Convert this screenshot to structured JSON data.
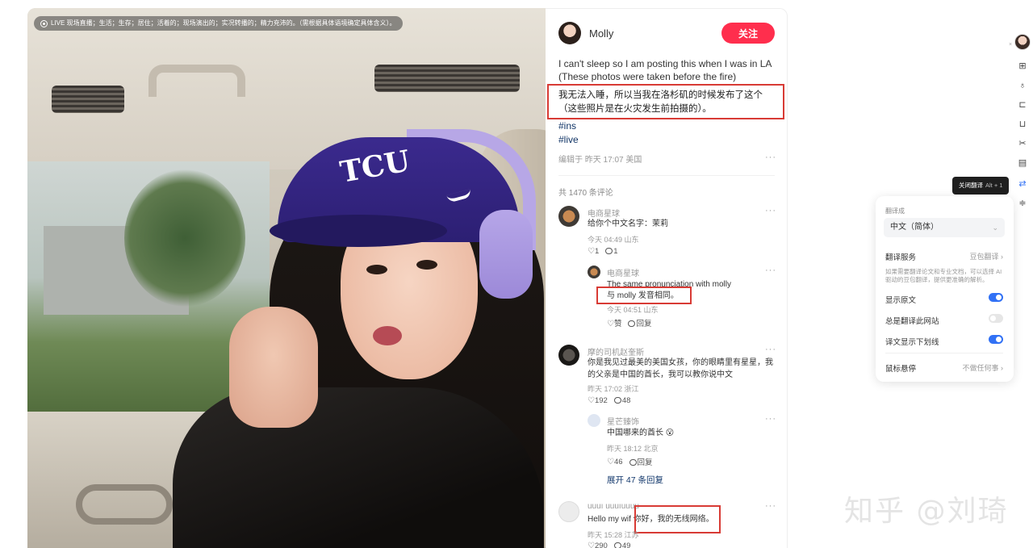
{
  "live_banner": "LIVE 现场直播；生活；生存；居住；活着的；现场演出的；实况转播的；精力充沛的。（需根据具体语境确定具体含义）。",
  "author": {
    "name": "Molly",
    "follow_label": "关注"
  },
  "post": {
    "line1": "I can't sleep so I am posting this when I was in LA",
    "line2": "(These photos were taken before the fire)",
    "translation": "我无法入睡，所以当我在洛杉矶的时候发布了这个（这些照片是在火灾发生前拍摄的）。",
    "tags": [
      "#ins",
      "#live"
    ],
    "edited": "编辑于 昨天 17:07 美国",
    "more": "···"
  },
  "comments_total": "共 1470 条评论",
  "comments": [
    {
      "name": "电商星球",
      "text": "给你个中文名字：茉莉",
      "time": "今天 04:49 山东",
      "likes": "1",
      "replies": "1"
    },
    {
      "name": "电商星球",
      "text1": "The same pronunciation with molly",
      "text2": "与 molly 发音相同。",
      "time": "今天 04:51 山东",
      "like_label": "赞",
      "reply_label": "回复"
    },
    {
      "name": "摩的司机赵奎斯",
      "text": "你是我见过最美的美国女孩，你的眼睛里有星星，我的父亲是中国的酋长，我可以教你说中文",
      "time": "昨天 17:02 浙江",
      "likes": "192",
      "replies": "48"
    },
    {
      "name": "星芒臻饰",
      "text": "中国哪来的酋长 😮",
      "time": "昨天 18:12 北京",
      "likes": "46",
      "reply_label": "回复"
    },
    {
      "name": "uuuı uuuıuuuu",
      "text_prefix": "Hello my wif",
      "text_translation": "你好，我的无线网络。",
      "time": "昨天 15:28 江苏",
      "likes": "290",
      "replies": "49"
    }
  ],
  "expand_replies": "展开 47 条回复",
  "translator": {
    "translate_to_label": "翻译成",
    "target_language": "中文（简体）",
    "service_label": "翻译服务",
    "service_value": "豆包翻译",
    "service_desc": "如果需要翻译论文和专业文档，可以选择 AI 驱动的豆包翻译，提供更准确的解析。",
    "show_original": "显示原文",
    "always_translate": "总是翻译此网站",
    "underline": "译文显示下划线",
    "hover_label": "鼠标悬停",
    "hover_value": "不做任何事",
    "toggles": {
      "show_original": true,
      "always_translate": false,
      "underline": true
    }
  },
  "tooltip": {
    "label": "关闭翻译",
    "keys": "Alt + 1"
  },
  "toolbar_icons": [
    "screenshot-icon",
    "microphone-icon",
    "crop-icon",
    "bookmark-icon",
    "scissors-icon",
    "document-icon",
    "translate-icon",
    "settings-icon"
  ],
  "watermark": "知乎 @刘琦",
  "colors": {
    "follow": "#ff2e4d",
    "highlight_box": "#d83b35",
    "toggle_on": "#3171f5",
    "tag": "#133667"
  }
}
